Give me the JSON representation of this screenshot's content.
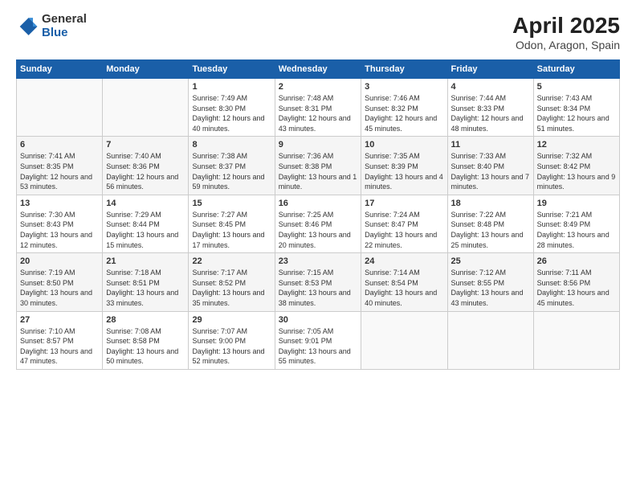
{
  "header": {
    "logo_general": "General",
    "logo_blue": "Blue",
    "main_title": "April 2025",
    "sub_title": "Odon, Aragon, Spain"
  },
  "days_of_week": [
    "Sunday",
    "Monday",
    "Tuesday",
    "Wednesday",
    "Thursday",
    "Friday",
    "Saturday"
  ],
  "weeks": [
    [
      {
        "day": "",
        "info": ""
      },
      {
        "day": "",
        "info": ""
      },
      {
        "day": "1",
        "sunrise": "7:49 AM",
        "sunset": "8:30 PM",
        "daylight": "12 hours and 40 minutes."
      },
      {
        "day": "2",
        "sunrise": "7:48 AM",
        "sunset": "8:31 PM",
        "daylight": "12 hours and 43 minutes."
      },
      {
        "day": "3",
        "sunrise": "7:46 AM",
        "sunset": "8:32 PM",
        "daylight": "12 hours and 45 minutes."
      },
      {
        "day": "4",
        "sunrise": "7:44 AM",
        "sunset": "8:33 PM",
        "daylight": "12 hours and 48 minutes."
      },
      {
        "day": "5",
        "sunrise": "7:43 AM",
        "sunset": "8:34 PM",
        "daylight": "12 hours and 51 minutes."
      }
    ],
    [
      {
        "day": "6",
        "sunrise": "7:41 AM",
        "sunset": "8:35 PM",
        "daylight": "12 hours and 53 minutes."
      },
      {
        "day": "7",
        "sunrise": "7:40 AM",
        "sunset": "8:36 PM",
        "daylight": "12 hours and 56 minutes."
      },
      {
        "day": "8",
        "sunrise": "7:38 AM",
        "sunset": "8:37 PM",
        "daylight": "12 hours and 59 minutes."
      },
      {
        "day": "9",
        "sunrise": "7:36 AM",
        "sunset": "8:38 PM",
        "daylight": "13 hours and 1 minute."
      },
      {
        "day": "10",
        "sunrise": "7:35 AM",
        "sunset": "8:39 PM",
        "daylight": "13 hours and 4 minutes."
      },
      {
        "day": "11",
        "sunrise": "7:33 AM",
        "sunset": "8:40 PM",
        "daylight": "13 hours and 7 minutes."
      },
      {
        "day": "12",
        "sunrise": "7:32 AM",
        "sunset": "8:42 PM",
        "daylight": "13 hours and 9 minutes."
      }
    ],
    [
      {
        "day": "13",
        "sunrise": "7:30 AM",
        "sunset": "8:43 PM",
        "daylight": "13 hours and 12 minutes."
      },
      {
        "day": "14",
        "sunrise": "7:29 AM",
        "sunset": "8:44 PM",
        "daylight": "13 hours and 15 minutes."
      },
      {
        "day": "15",
        "sunrise": "7:27 AM",
        "sunset": "8:45 PM",
        "daylight": "13 hours and 17 minutes."
      },
      {
        "day": "16",
        "sunrise": "7:25 AM",
        "sunset": "8:46 PM",
        "daylight": "13 hours and 20 minutes."
      },
      {
        "day": "17",
        "sunrise": "7:24 AM",
        "sunset": "8:47 PM",
        "daylight": "13 hours and 22 minutes."
      },
      {
        "day": "18",
        "sunrise": "7:22 AM",
        "sunset": "8:48 PM",
        "daylight": "13 hours and 25 minutes."
      },
      {
        "day": "19",
        "sunrise": "7:21 AM",
        "sunset": "8:49 PM",
        "daylight": "13 hours and 28 minutes."
      }
    ],
    [
      {
        "day": "20",
        "sunrise": "7:19 AM",
        "sunset": "8:50 PM",
        "daylight": "13 hours and 30 minutes."
      },
      {
        "day": "21",
        "sunrise": "7:18 AM",
        "sunset": "8:51 PM",
        "daylight": "13 hours and 33 minutes."
      },
      {
        "day": "22",
        "sunrise": "7:17 AM",
        "sunset": "8:52 PM",
        "daylight": "13 hours and 35 minutes."
      },
      {
        "day": "23",
        "sunrise": "7:15 AM",
        "sunset": "8:53 PM",
        "daylight": "13 hours and 38 minutes."
      },
      {
        "day": "24",
        "sunrise": "7:14 AM",
        "sunset": "8:54 PM",
        "daylight": "13 hours and 40 minutes."
      },
      {
        "day": "25",
        "sunrise": "7:12 AM",
        "sunset": "8:55 PM",
        "daylight": "13 hours and 43 minutes."
      },
      {
        "day": "26",
        "sunrise": "7:11 AM",
        "sunset": "8:56 PM",
        "daylight": "13 hours and 45 minutes."
      }
    ],
    [
      {
        "day": "27",
        "sunrise": "7:10 AM",
        "sunset": "8:57 PM",
        "daylight": "13 hours and 47 minutes."
      },
      {
        "day": "28",
        "sunrise": "7:08 AM",
        "sunset": "8:58 PM",
        "daylight": "13 hours and 50 minutes."
      },
      {
        "day": "29",
        "sunrise": "7:07 AM",
        "sunset": "9:00 PM",
        "daylight": "13 hours and 52 minutes."
      },
      {
        "day": "30",
        "sunrise": "7:05 AM",
        "sunset": "9:01 PM",
        "daylight": "13 hours and 55 minutes."
      },
      {
        "day": "",
        "info": ""
      },
      {
        "day": "",
        "info": ""
      },
      {
        "day": "",
        "info": ""
      }
    ]
  ]
}
